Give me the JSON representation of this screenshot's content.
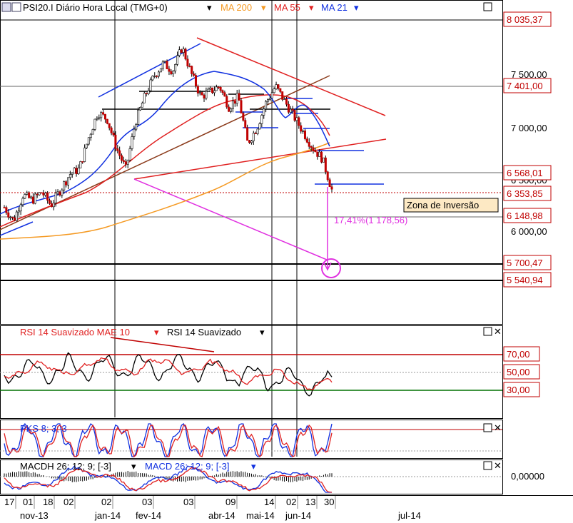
{
  "header": {
    "symbol": "PSI20.I Diário Hora Local (TMG+0)",
    "ma200": "MA 200",
    "ma55": "MA 55",
    "ma21": "MA 21",
    "caret": "▾"
  },
  "colors": {
    "ma200": "#f59a23",
    "ma55": "#e02020",
    "ma21": "#1030e0",
    "magenta": "#e030e0",
    "up": "#ffffff",
    "down": "#c00000",
    "green": "#007000"
  },
  "price_labels": {
    "p8035": "8 035,37",
    "p7401": "7 401,00",
    "p6568": "6 568,01",
    "p6500": "6 500,00",
    "p6353": "6 353,85",
    "p6148": "6 148,98",
    "p5700": "5 700,47",
    "p5540": "5 540,94",
    "t7500": "7 500,00",
    "t7000": "7 000,00",
    "t6000": "6 000,00"
  },
  "annotations": {
    "zona": "Zona de  Inversão",
    "projection": "17,41%(1 178,56)"
  },
  "rsi": {
    "title_a": "RSI 14 Suavizado MAE 10",
    "title_b": "RSI 14 Suavizado",
    "l70": "70,00",
    "l50": "50,00",
    "l30": "30,00"
  },
  "pks": {
    "title": "PKS 8; 3; 3"
  },
  "macd": {
    "title_a": "MACDH 26; 12; 9; [-3]",
    "title_b": "MACD 26; 12; 9; [-3]",
    "zero": "0,00000"
  },
  "xaxis": {
    "days": [
      "17",
      "01",
      "18",
      "02",
      "02",
      "03",
      "03",
      "09",
      "14",
      "02",
      "13",
      "30"
    ],
    "months": [
      "nov-13",
      "jan-14",
      "fev-14",
      "abr-14",
      "mai-14",
      "jun-14",
      "jul-14"
    ]
  },
  "chart_data": {
    "type": "candlestick",
    "title": "PSI20.I Diário Hora Local (TMG+0)",
    "y_ticks": [
      6000,
      6500,
      7000,
      7500
    ],
    "price_axis_labels": [
      8035.37,
      7401.0,
      6568.01,
      6353.85,
      6148.98,
      5700.47,
      5540.94
    ],
    "series": [
      {
        "name": "MA 200"
      },
      {
        "name": "MA 55"
      },
      {
        "name": "MA 21"
      }
    ],
    "close_path": [
      6230,
      6100,
      6350,
      6300,
      6380,
      6250,
      6400,
      6550,
      6600,
      6900,
      7150,
      7080,
      6800,
      6600,
      7050,
      7300,
      7500,
      7620,
      7550,
      7780,
      7520,
      7300,
      7350,
      7400,
      7200,
      7300,
      6850,
      7000,
      7250,
      7400,
      7250,
      7100,
      6950,
      6800,
      6700,
      6400
    ],
    "indicators": {
      "rsi_levels": [
        70,
        50,
        30
      ],
      "macd_zero": 0
    }
  }
}
